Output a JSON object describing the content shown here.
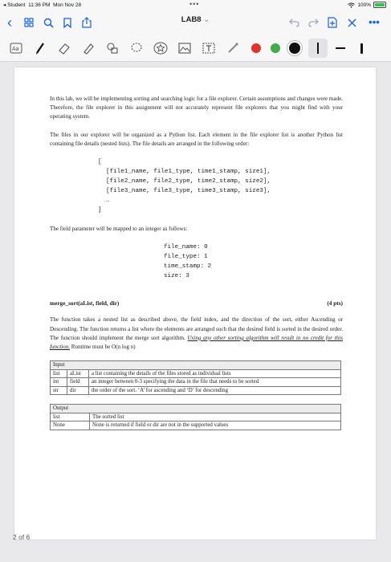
{
  "status_bar": {
    "carrier": "◂ Student",
    "time": "11:36 PM",
    "date": "Mon Nov 28",
    "battery": "100%"
  },
  "nav": {
    "title": "LAB8",
    "title_chevron": "⌄"
  },
  "colors": {
    "accent": "#1a63d8",
    "red": "#e0332f",
    "green": "#3fae49",
    "black": "#111111"
  },
  "document": {
    "intro": "In this lab, we will be implementing sorting and searching logic for a file explorer. Certain assumptions and changes were made. Therefore, the file explorer in this assignment will not accurately represent file explorers that you might find with your operating system.",
    "files_desc": "The files in our explorer will be organized as a Python list. Each element in the file explorer list is another Python list containing file details (nested lists). The file details are arranged in the following order:",
    "code_open": "[",
    "code_lines": [
      "[file1_name, file1_type, time1_stamp, size1],",
      "[file2_name, file2_type, time2_stamp, size2],",
      "[file3_name, file3_type, time3_stamp, size3],",
      "…"
    ],
    "code_close": "]",
    "field_desc": "The field parameter will be mapped to an integer as follows:",
    "mapping": [
      "file_name: 0",
      "file_type: 1",
      "time_stamp: 2",
      "size: 3"
    ],
    "fn_signature": "merge_sort(aList, field, dir)",
    "fn_points": "(4 pts)",
    "fn_desc_1": "The function takes a nested list as described above, the field index, and the direction of the sort, either Ascending or Descending. The function returns a list where the elements are arranged such that the desired field is sorted in the desired order. The function should implement the merge sort algorithm. ",
    "fn_desc_warning": "Using any other sorting algorithm will result in no credit for this function.",
    "fn_desc_2": " Runtime must be O(n log n)",
    "input_table": {
      "header": "Input",
      "rows": [
        [
          "list",
          "aList",
          "a list containing the details of the files stored as individual lists"
        ],
        [
          "int",
          "field",
          "an integer between 0-3 specifying the data in the file that needs to be sorted"
        ],
        [
          "str",
          "dir",
          "the order of the sort. ‘A’ for ascending and ‘D’ for descending"
        ]
      ]
    },
    "output_table": {
      "header": "Output",
      "rows": [
        [
          "list",
          "The sorted list"
        ],
        [
          "None",
          "None is returned if field or dir are not in the supported values"
        ]
      ]
    }
  },
  "page_indicator": "2 of 6"
}
